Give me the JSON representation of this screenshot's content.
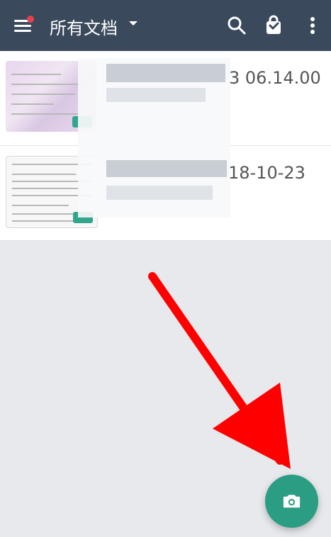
{
  "header": {
    "title": "所有文档",
    "menu_icon": "hamburger-menu-icon",
    "search_icon": "search-icon",
    "bag_icon": "shopping-bag-icon",
    "more_icon": "more-vert-icon"
  },
  "documents": [
    {
      "date_suffix": "3 06.14.00"
    },
    {
      "date_suffix": "18-10-23"
    }
  ],
  "fab": {
    "icon": "camera-icon"
  },
  "colors": {
    "header_bg": "#3a4a5c",
    "accent": "#2a9d83",
    "alert_dot": "#e8414b",
    "arrow": "#ff0000"
  }
}
